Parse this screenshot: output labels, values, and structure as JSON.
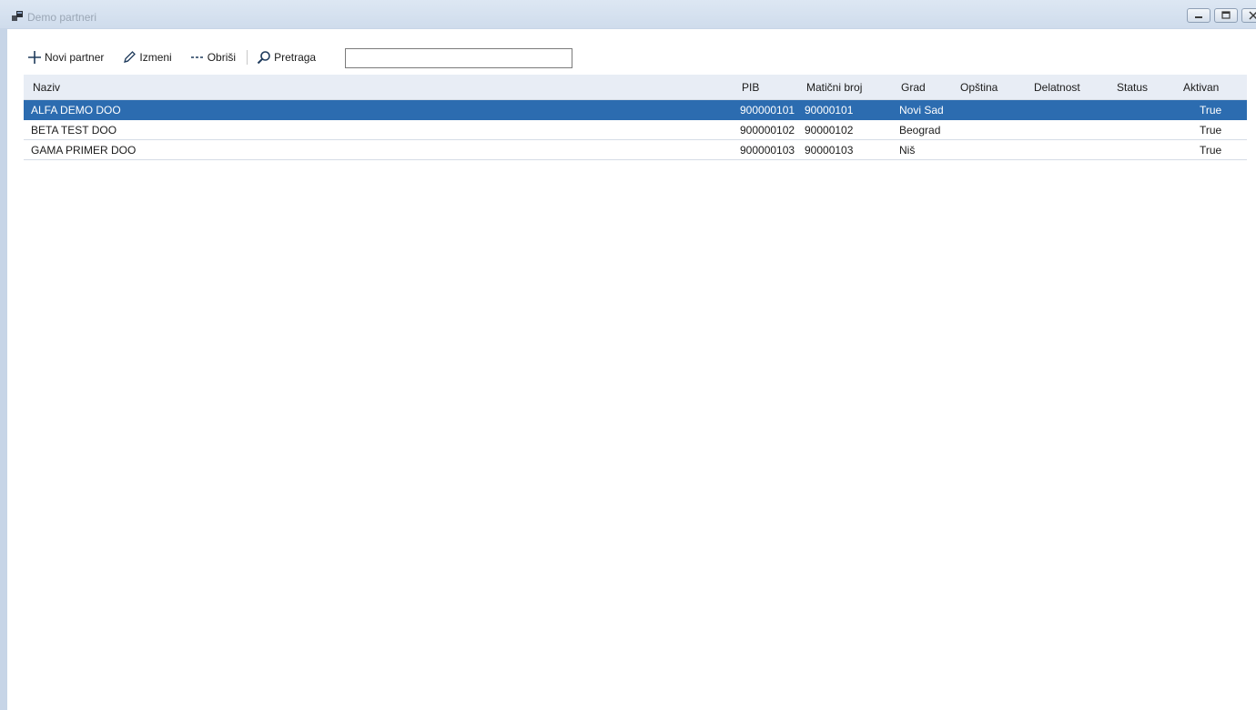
{
  "window": {
    "title": "Demo partneri",
    "controls": [
      "minimize-icon",
      "restore-icon",
      "close-icon"
    ]
  },
  "toolbar": {
    "new_label": "Novi partner",
    "edit_label": "Izmeni",
    "delete_label": "Obriši",
    "search_label": "Pretraga",
    "search_value": ""
  },
  "grid": {
    "columns": [
      "Naziv",
      "PIB",
      "Matični broj",
      "Grad",
      "Opština",
      "Delatnost",
      "Status",
      "Aktivan"
    ],
    "rows": [
      {
        "naziv": "ALFA DEMO DOO",
        "pib": "900000101",
        "mb": "90000101",
        "grad": "Novi Sad",
        "opstina": "",
        "delatnost": "",
        "status": "",
        "aktivan": "True"
      },
      {
        "naziv": "BETA TEST DOO",
        "pib": "900000102",
        "mb": "90000102",
        "grad": "Beograd",
        "opstina": "",
        "delatnost": "",
        "status": "",
        "aktivan": "True"
      },
      {
        "naziv": "GAMA PRIMER DOO",
        "pib": "900000103",
        "mb": "90000103",
        "grad": "Niš",
        "opstina": "",
        "delatnost": "",
        "status": "",
        "aktivan": "True"
      }
    ],
    "selected_row": 0
  },
  "colors": {
    "selection": "#2c6cb0",
    "header_bg": "#e8edf5",
    "titlebar": "#d4e0ee"
  }
}
